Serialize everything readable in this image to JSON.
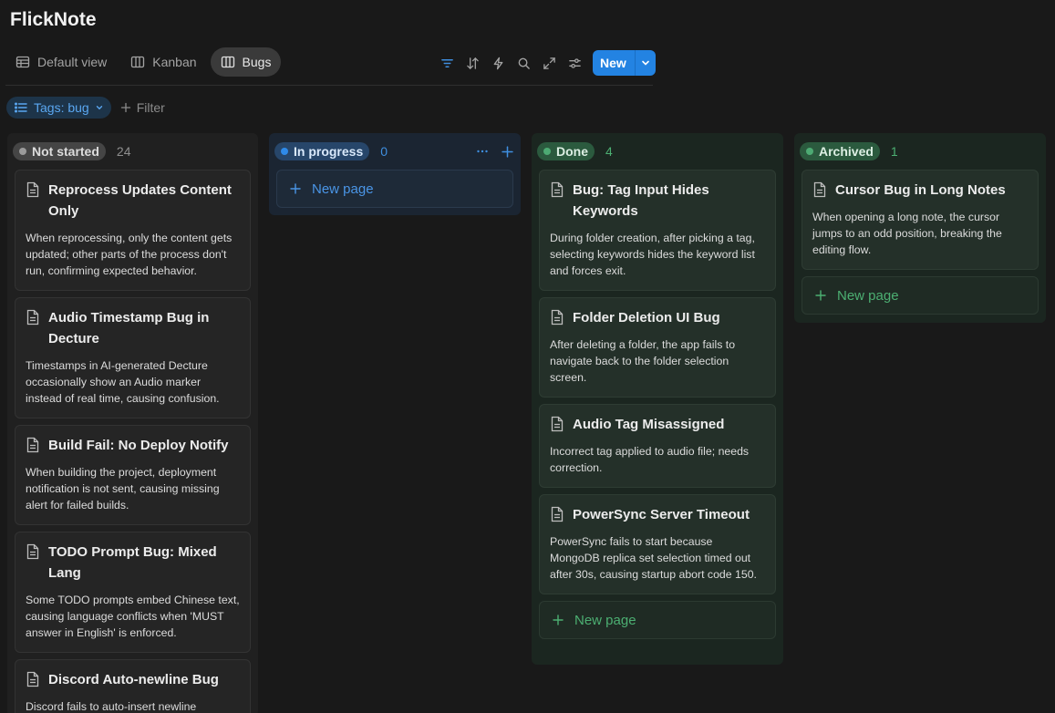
{
  "app": {
    "title": "FlickNote"
  },
  "views": [
    {
      "label": "Default view",
      "icon": "table-icon"
    },
    {
      "label": "Kanban",
      "icon": "board-icon"
    },
    {
      "label": "Bugs",
      "icon": "board-icon",
      "active": true
    }
  ],
  "toolbar": {
    "icons": [
      "filter-icon",
      "sort-icon",
      "lightning-icon",
      "search-icon",
      "expand-icon",
      "settings-sliders-icon"
    ],
    "new_label": "New"
  },
  "filters": {
    "tag_filter": "Tags: bug",
    "add_filter": "Filter"
  },
  "columns": {
    "not_started": {
      "status": "Not started",
      "count": "24",
      "cards": [
        {
          "title": "Reprocess Updates Content Only",
          "desc": "When reprocessing, only the content gets updated; other parts of the process don't run, confirming expected behavior."
        },
        {
          "title": "Audio Timestamp Bug in Decture",
          "desc": "Timestamps in AI-generated Decture occasionally show an Audio marker instead of real time, causing confusion."
        },
        {
          "title": "Build Fail: No Deploy Notify",
          "desc": "When building the project, deployment notification is not sent, causing missing alert for failed builds."
        },
        {
          "title": "TODO Prompt Bug: Mixed Lang",
          "desc": "Some TODO prompts embed Chinese text, causing language conflicts when 'MUST answer in English' is enforced."
        },
        {
          "title": "Discord Auto-newline Bug",
          "desc": "Discord fails to auto-insert newline"
        }
      ]
    },
    "in_progress": {
      "status": "In progress",
      "count": "0",
      "new_page": "New page"
    },
    "done": {
      "status": "Done",
      "count": "4",
      "cards": [
        {
          "title": "Bug: Tag Input Hides Keywords",
          "desc": "During folder creation, after picking a tag, selecting keywords hides the keyword list and forces exit."
        },
        {
          "title": "Folder Deletion UI Bug",
          "desc": "After deleting a folder, the app fails to navigate back to the folder selection screen."
        },
        {
          "title": "Audio Tag Misassigned",
          "desc": "Incorrect tag applied to audio file; needs correction."
        },
        {
          "title": "PowerSync Server Timeout",
          "desc": "PowerSync fails to start because MongoDB replica set selection timed out after 30s, causing startup abort code 150."
        }
      ],
      "new_page": "New page"
    },
    "archived": {
      "status": "Archived",
      "count": "1",
      "cards": [
        {
          "title": "Cursor Bug in Long Notes",
          "desc": "When opening a long note, the cursor jumps to an odd position, breaking the editing flow."
        }
      ],
      "new_page": "New page"
    }
  },
  "colors": {
    "accent": "#2383e2",
    "done_green": "#4caf72",
    "in_progress_blue": "#2f8ae8"
  }
}
